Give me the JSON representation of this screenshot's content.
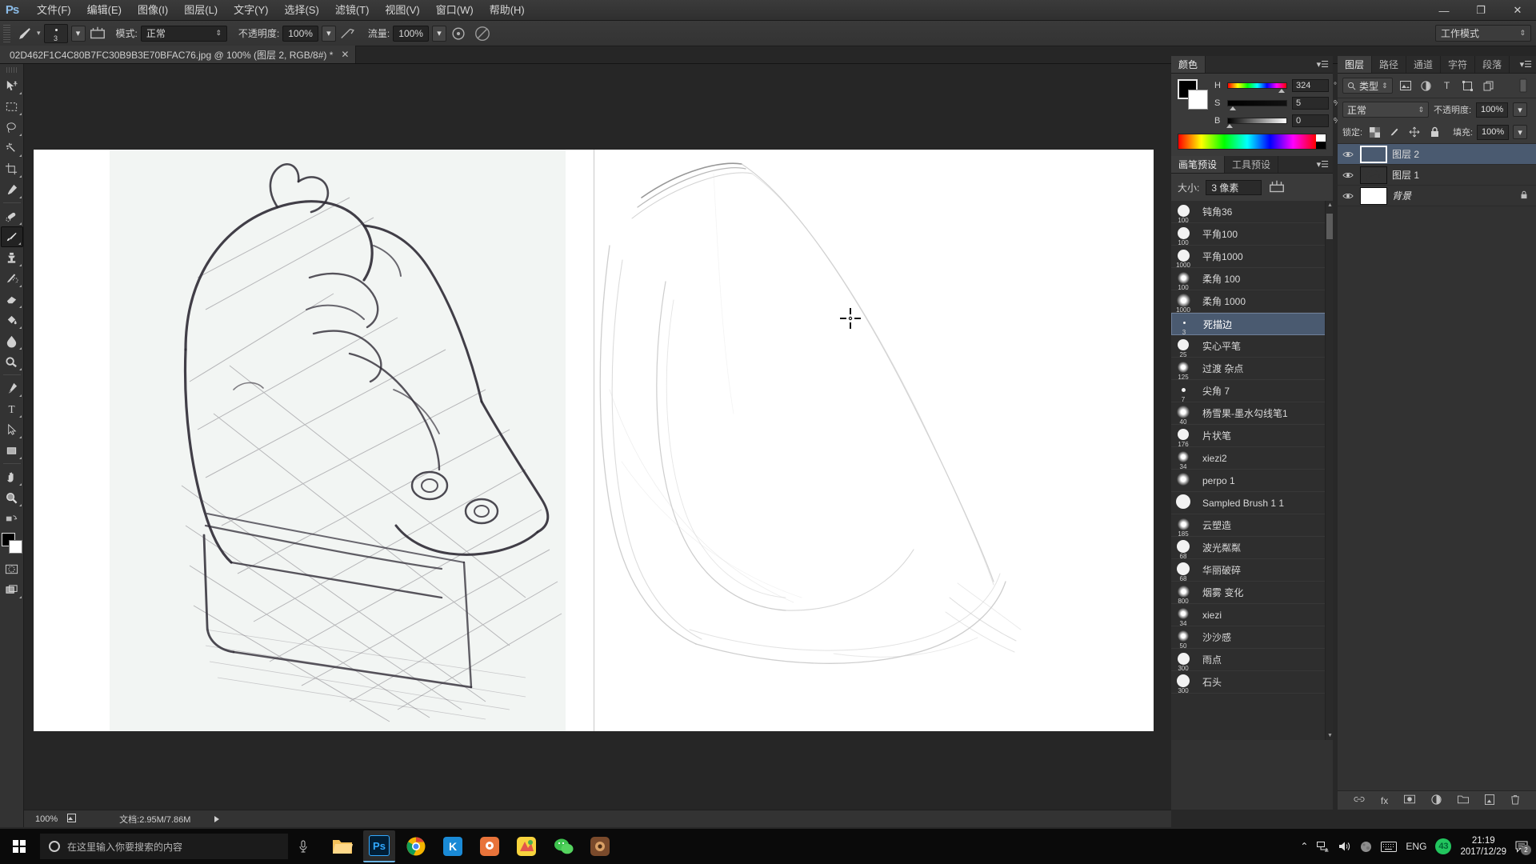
{
  "app": {
    "logo": "Ps",
    "workspace": "工作模式"
  },
  "menubar": [
    {
      "label": "文件(F)",
      "name": "menu-file"
    },
    {
      "label": "编辑(E)",
      "name": "menu-edit"
    },
    {
      "label": "图像(I)",
      "name": "menu-image"
    },
    {
      "label": "图层(L)",
      "name": "menu-layer"
    },
    {
      "label": "文字(Y)",
      "name": "menu-type"
    },
    {
      "label": "选择(S)",
      "name": "menu-select"
    },
    {
      "label": "滤镜(T)",
      "name": "menu-filter"
    },
    {
      "label": "视图(V)",
      "name": "menu-view"
    },
    {
      "label": "窗口(W)",
      "name": "menu-window"
    },
    {
      "label": "帮助(H)",
      "name": "menu-help"
    }
  ],
  "window_controls": {
    "minimize": "—",
    "maximize": "❐",
    "close": "✕"
  },
  "options_bar": {
    "brush_size": "3",
    "mode_label": "模式:",
    "mode_value": "正常",
    "opacity_label": "不透明度:",
    "opacity_value": "100%",
    "flow_label": "流量:",
    "flow_value": "100%"
  },
  "document_tab": {
    "title": "02D462F1C4C80B7FC30B9B3E70BFAC76.jpg @ 100% (图层 2, RGB/8#) *",
    "close": "✕"
  },
  "toolbar": [
    {
      "name": "move-tool",
      "icon": "move-icon"
    },
    {
      "name": "marquee-tool",
      "icon": "marquee-icon"
    },
    {
      "name": "lasso-tool",
      "icon": "lasso-icon"
    },
    {
      "name": "magic-wand-tool",
      "icon": "magic-wand-icon"
    },
    {
      "name": "crop-tool",
      "icon": "crop-icon"
    },
    {
      "name": "eyedropper-tool",
      "icon": "eyedropper-icon"
    },
    {
      "name": "healing-brush-tool",
      "icon": "healing-brush-icon"
    },
    {
      "name": "brush-tool",
      "icon": "brush-icon"
    },
    {
      "name": "clone-stamp-tool",
      "icon": "clone-stamp-icon"
    },
    {
      "name": "history-brush-tool",
      "icon": "history-brush-icon"
    },
    {
      "name": "eraser-tool",
      "icon": "eraser-icon"
    },
    {
      "name": "gradient-tool",
      "icon": "paint-bucket-icon"
    },
    {
      "name": "blur-tool",
      "icon": "blur-drop-icon"
    },
    {
      "name": "dodge-tool",
      "icon": "dodge-icon"
    },
    {
      "name": "pen-tool",
      "icon": "pen-icon"
    },
    {
      "name": "type-tool",
      "icon": "type-icon"
    },
    {
      "name": "path-selection-tool",
      "icon": "path-arrow-icon"
    },
    {
      "name": "rectangle-tool",
      "icon": "rectangle-icon"
    },
    {
      "name": "hand-tool",
      "icon": "hand-icon"
    },
    {
      "name": "zoom-tool",
      "icon": "magnifier-icon"
    },
    {
      "name": "edit-toolbar",
      "icon": "ellipsis-icon"
    }
  ],
  "color_panel": {
    "tab": "颜色",
    "channels": [
      {
        "letter": "H",
        "value": "324",
        "unit": "°",
        "pos": 90
      },
      {
        "letter": "S",
        "value": "5",
        "unit": "%",
        "pos": 5
      },
      {
        "letter": "B",
        "value": "0",
        "unit": "%",
        "pos": 0
      }
    ]
  },
  "brush_panel": {
    "tabs": [
      {
        "label": "画笔预设",
        "active": true
      },
      {
        "label": "工具预设",
        "active": false
      }
    ],
    "size_label": "大小:",
    "size_value": "3 像素",
    "brushes": [
      {
        "name": "钝角36",
        "num": "100",
        "size": 15,
        "soft": false
      },
      {
        "name": "平角100",
        "num": "100",
        "size": 15,
        "soft": false
      },
      {
        "name": "平角1000",
        "num": "1000",
        "size": 15,
        "soft": false
      },
      {
        "name": "柔角 100",
        "num": "100",
        "size": 15,
        "soft": true
      },
      {
        "name": "柔角 1000",
        "num": "1000",
        "size": 17,
        "soft": true
      },
      {
        "name": "死描边",
        "num": "3",
        "size": 3,
        "soft": false,
        "selected": true
      },
      {
        "name": "实心平笔",
        "num": "25",
        "size": 14,
        "soft": false
      },
      {
        "name": "过渡 杂点",
        "num": "125",
        "size": 14,
        "soft": true
      },
      {
        "name": "尖角 7",
        "num": "7",
        "size": 5,
        "soft": false
      },
      {
        "name": "杨雪果-墨水勾线笔1",
        "num": "40",
        "size": 16,
        "soft": true
      },
      {
        "name": "片状笔",
        "num": "176",
        "size": 14,
        "soft": false
      },
      {
        "name": "xiezi2",
        "num": "34",
        "size": 14,
        "soft": true
      },
      {
        "name": "perpo 1",
        "num": "",
        "size": 16,
        "soft": true
      },
      {
        "name": "Sampled Brush 1 1",
        "num": "",
        "size": 18,
        "soft": false
      },
      {
        "name": "云塑造",
        "num": "185",
        "size": 15,
        "soft": true
      },
      {
        "name": "波光粼粼",
        "num": "68",
        "size": 16,
        "soft": false
      },
      {
        "name": "华丽破碎",
        "num": "68",
        "size": 16,
        "soft": false
      },
      {
        "name": "烟雾 变化",
        "num": "800",
        "size": 15,
        "soft": true
      },
      {
        "name": "xiezi",
        "num": "34",
        "size": 14,
        "soft": true
      },
      {
        "name": "沙沙感",
        "num": "50",
        "size": 14,
        "soft": true
      },
      {
        "name": "雨点",
        "num": "300",
        "size": 15,
        "soft": false
      },
      {
        "name": "石头",
        "num": "300",
        "size": 16,
        "soft": false
      }
    ]
  },
  "layers_panel": {
    "tabs": [
      {
        "label": "图层",
        "active": true
      },
      {
        "label": "路径",
        "active": false
      },
      {
        "label": "通道",
        "active": false
      },
      {
        "label": "字符",
        "active": false
      },
      {
        "label": "段落",
        "active": false
      }
    ],
    "filter_label": "类型",
    "blend_mode": "正常",
    "opacity_label": "不透明度:",
    "opacity_value": "100%",
    "lock_label": "锁定:",
    "fill_label": "填充:",
    "fill_value": "100%",
    "layers": [
      {
        "name": "图层 2",
        "visible": true,
        "selected": true,
        "kind": "empty",
        "locked": false
      },
      {
        "name": "图层 1",
        "visible": true,
        "selected": false,
        "kind": "sketch",
        "locked": false
      },
      {
        "name": "背景",
        "visible": true,
        "selected": false,
        "kind": "white",
        "locked": true
      }
    ]
  },
  "status_bar": {
    "zoom": "100%",
    "doc_info": "文档:2.95M/7.86M"
  },
  "taskbar": {
    "search_placeholder": "在这里输入你要搜索的内容",
    "apps": [
      {
        "name": "file-explorer",
        "label": "📁"
      },
      {
        "name": "photoshop",
        "label": "Ps",
        "active": true
      },
      {
        "name": "chrome",
        "label": "◉"
      },
      {
        "name": "kugou",
        "label": "K"
      },
      {
        "name": "app-orange",
        "label": "●"
      },
      {
        "name": "app-colorful",
        "label": "◆"
      },
      {
        "name": "wechat",
        "label": "✆"
      },
      {
        "name": "app-brown",
        "label": "☕"
      }
    ],
    "tray": {
      "language": "ENG",
      "badge_count": "43",
      "time": "21:19",
      "date": "2017/12/29",
      "notification_count": "2"
    }
  },
  "colors": {
    "accent": "#4a5a70",
    "panel_bg": "#323232",
    "toolbar_bg": "#333333",
    "canvas_bg": "#262626",
    "foreground": "#000000",
    "background": "#ffffff"
  }
}
